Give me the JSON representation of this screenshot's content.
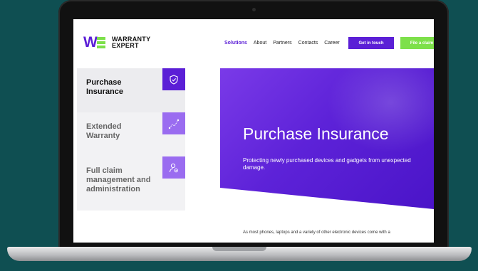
{
  "site": {
    "logo_line1": "WARRANTY",
    "logo_line2": "EXPERT"
  },
  "nav": {
    "items": [
      "Solutions",
      "About",
      "Partners",
      "Contacts",
      "Career"
    ],
    "active_index": 0
  },
  "buttons": {
    "contact": "Get in touch",
    "claim": "File a claim"
  },
  "sidebar": {
    "items": [
      {
        "label": "Purchase Insurance",
        "icon": "shield-check-icon"
      },
      {
        "label": "Extended Warranty",
        "icon": "trend-line-icon"
      },
      {
        "label": "Full claim management and administration",
        "icon": "person-gear-icon"
      }
    ]
  },
  "hero": {
    "title": "Purchase Insurance",
    "subtitle": "Protecting newly purchased devices and gadgets from unexpected damage."
  },
  "content": {
    "paragraph": "As most phones, laptops and a variety of other electronic devices come with a"
  },
  "colors": {
    "brand_purple": "#5b1fd6",
    "brand_green": "#7de04a",
    "background": "#0f4f52"
  }
}
